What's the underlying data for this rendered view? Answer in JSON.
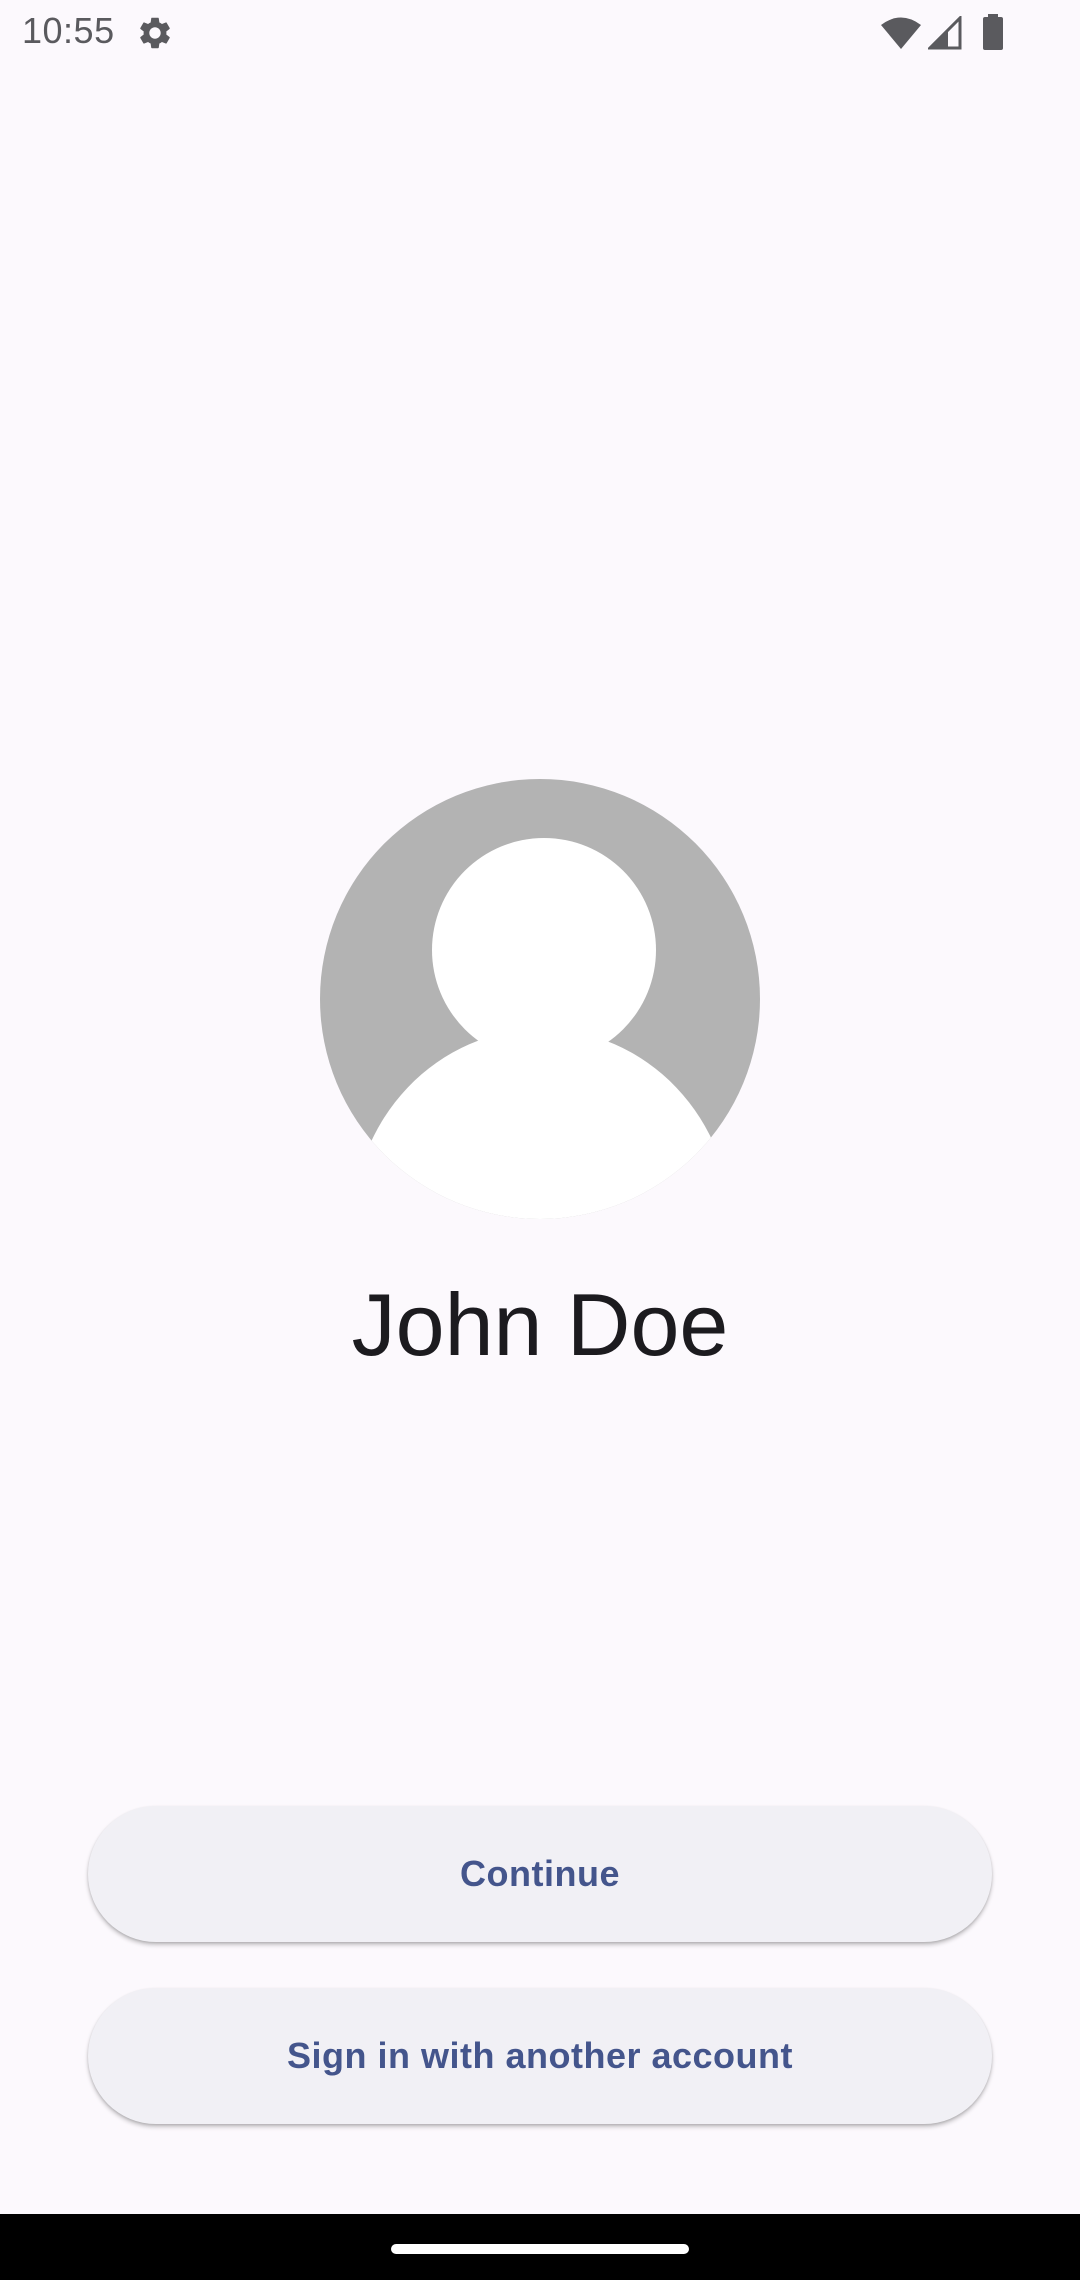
{
  "status_bar": {
    "time": "10:55",
    "icons": [
      "gear-icon",
      "wifi-icon",
      "cell-signal-icon",
      "battery-icon"
    ]
  },
  "profile": {
    "avatar_icon": "default-avatar-icon",
    "name": "John Doe"
  },
  "actions": {
    "continue_label": "Continue",
    "another_account_label": "Sign in with another account"
  },
  "colors": {
    "background": "#fcf9fd",
    "button_background": "#f1f0f5",
    "button_text": "#44558c",
    "name_text": "#1c1b1f",
    "avatar_gray": "#b3b3b3"
  }
}
